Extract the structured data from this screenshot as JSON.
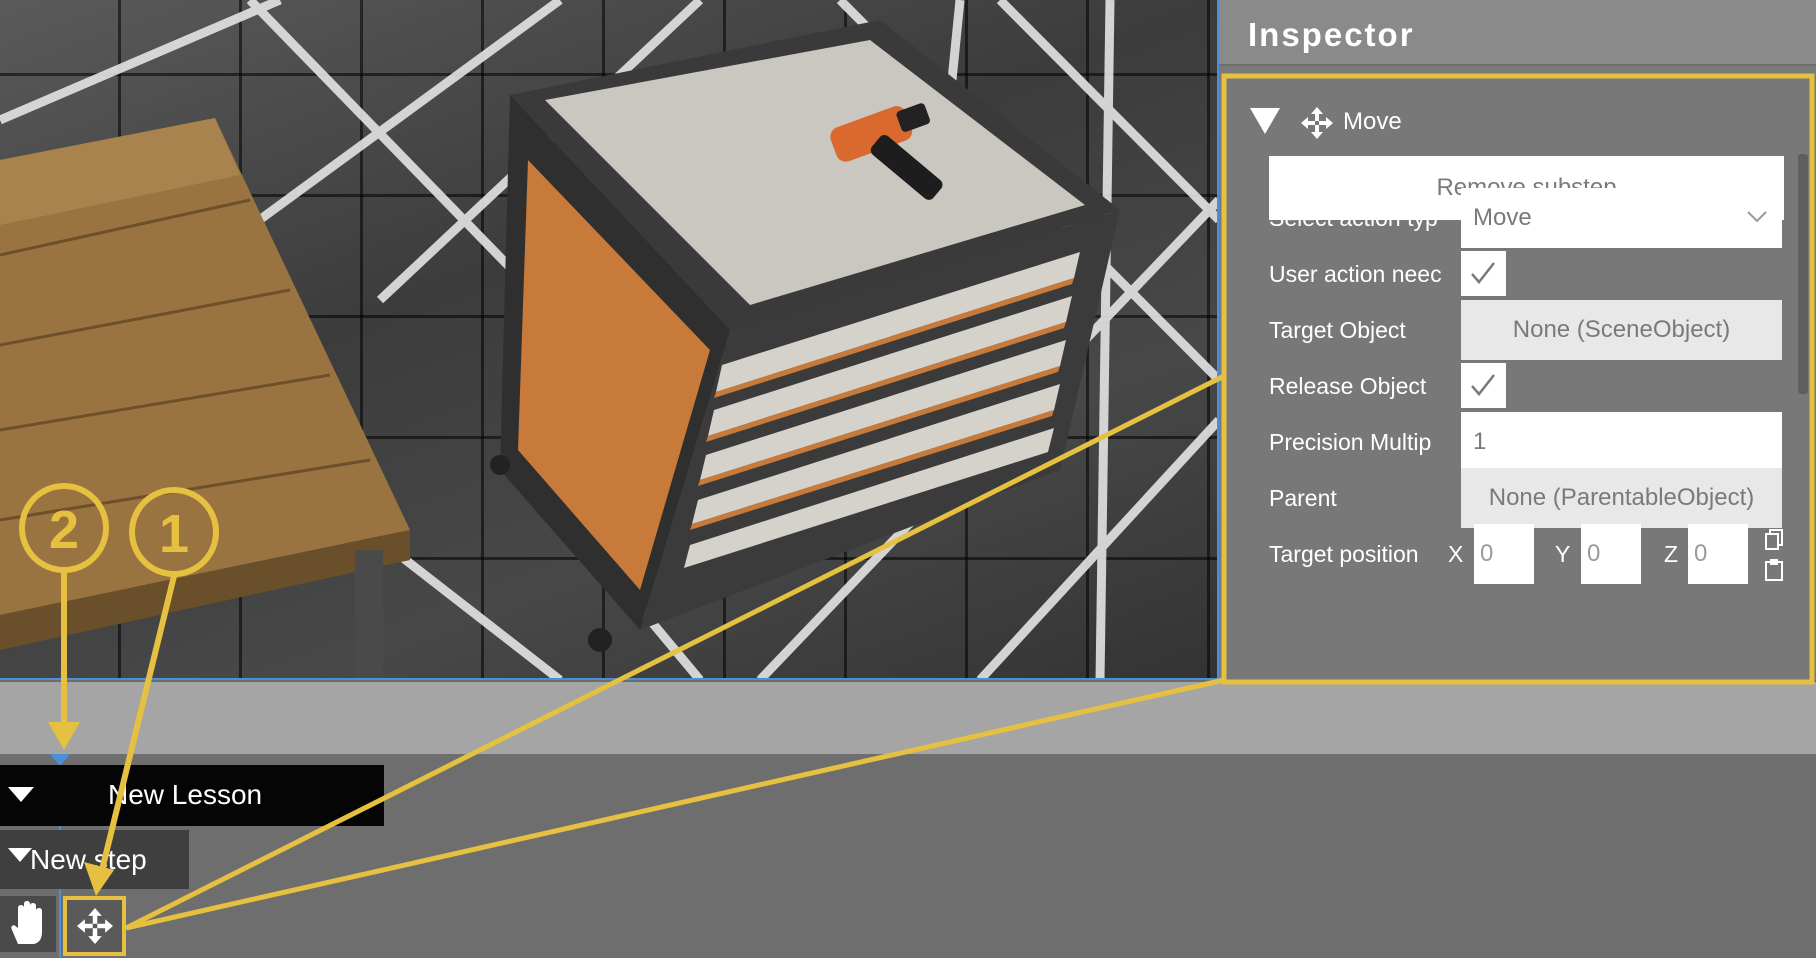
{
  "inspector": {
    "title": "Inspector",
    "section": "Move",
    "remove_button": "Remove substep",
    "properties": {
      "action_type_label": "Select action typ",
      "action_type_value": "Move",
      "user_action_label": "User action neec",
      "user_action_checked": true,
      "target_object_label": "Target  Object",
      "target_object_value": "None (SceneObject)",
      "release_object_label": "Release  Object",
      "release_object_checked": true,
      "precision_label": "Precision  Multip",
      "precision_value": "1",
      "parent_label": "Parent",
      "parent_value": "None (ParentableObject)",
      "target_position_label": "Target position",
      "x_label": "X",
      "x_value": "0",
      "y_label": "Y",
      "y_value": "0",
      "z_label": "Z",
      "z_value": "0"
    }
  },
  "timeline": {
    "lesson_label": "New Lesson",
    "step_label": "New step",
    "substeps": [
      "hand-icon",
      "move-icon"
    ]
  },
  "annotations": {
    "callout_1": "1",
    "callout_2": "2",
    "color": "#e6c040"
  },
  "colors": {
    "accent_blue": "#4a90d9",
    "callout_yellow": "#e6c040"
  }
}
